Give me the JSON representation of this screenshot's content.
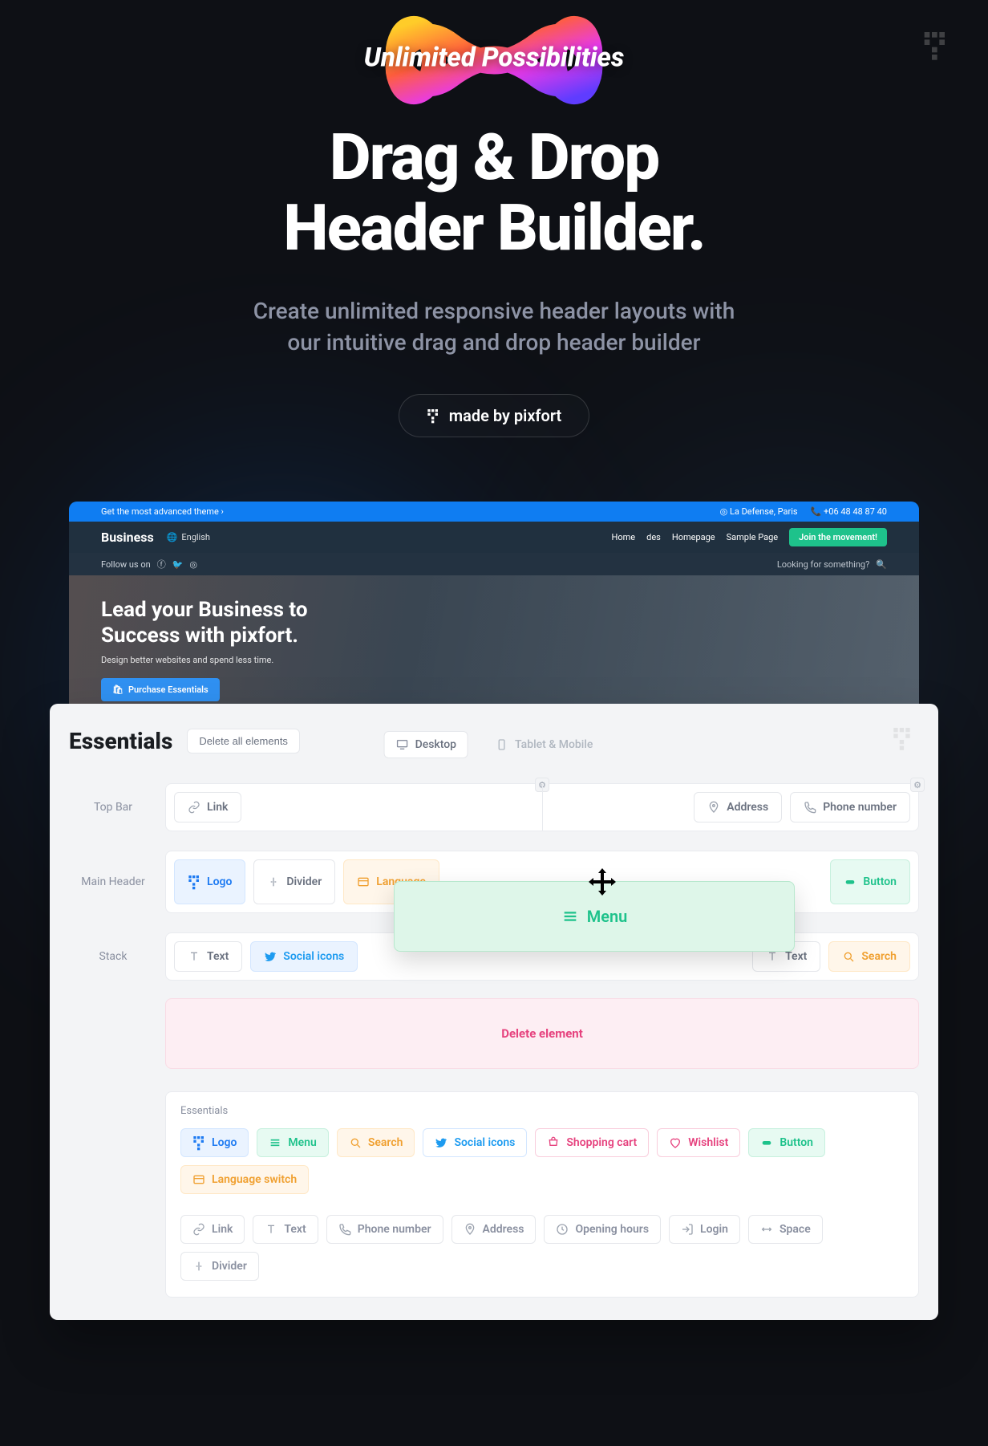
{
  "hero": {
    "badge": "Unlimited Possibilities",
    "title_line1": "Drag & Drop",
    "title_line2": "Header Builder.",
    "subtitle_line1": "Create unlimited responsive header layouts with",
    "subtitle_line2": "our intuitive drag and drop header builder",
    "pill_label": "made by pixfort"
  },
  "preview": {
    "topbar": {
      "left": "Get the most advanced theme ›",
      "address": "La Defense, Paris",
      "phone": "+06 48 48 87 40"
    },
    "nav": {
      "brand": "Business",
      "lang": "English",
      "menu": [
        "Home",
        "des",
        "Homepage",
        "Sample Page"
      ],
      "cta": "Join the movement!"
    },
    "sub": {
      "follow": "Follow us on",
      "search": "Looking for something?"
    },
    "heroTitle1": "Lead your Business to",
    "heroTitle2": "Success with pixfort.",
    "heroSub": "Design better websites and spend less time.",
    "purchase": "Purchase Essentials"
  },
  "builder": {
    "title": "Essentials",
    "delete_all": "Delete all elements",
    "viewports": {
      "desktop": "Desktop",
      "mobile": "Tablet & Mobile"
    },
    "rows": {
      "topbar": {
        "label": "Top Bar",
        "left": [
          "Link"
        ],
        "right": [
          "Address",
          "Phone number"
        ]
      },
      "main": {
        "label": "Main Header",
        "left": [
          "Logo",
          "Divider",
          "Language"
        ],
        "right": [
          "Button"
        ]
      },
      "stack": {
        "label": "Stack",
        "left": [
          "Text",
          "Social icons"
        ],
        "right": [
          "Text",
          "Search"
        ]
      }
    },
    "dragging": "Menu",
    "delete_zone": "Delete element",
    "palette": {
      "label": "Essentials",
      "row1": [
        "Logo",
        "Menu",
        "Search",
        "Social icons",
        "Shopping cart",
        "Wishlist",
        "Button",
        "Language switch"
      ],
      "row2": [
        "Link",
        "Text",
        "Phone number",
        "Address",
        "Opening hours",
        "Login",
        "Space",
        "Divider"
      ]
    }
  }
}
